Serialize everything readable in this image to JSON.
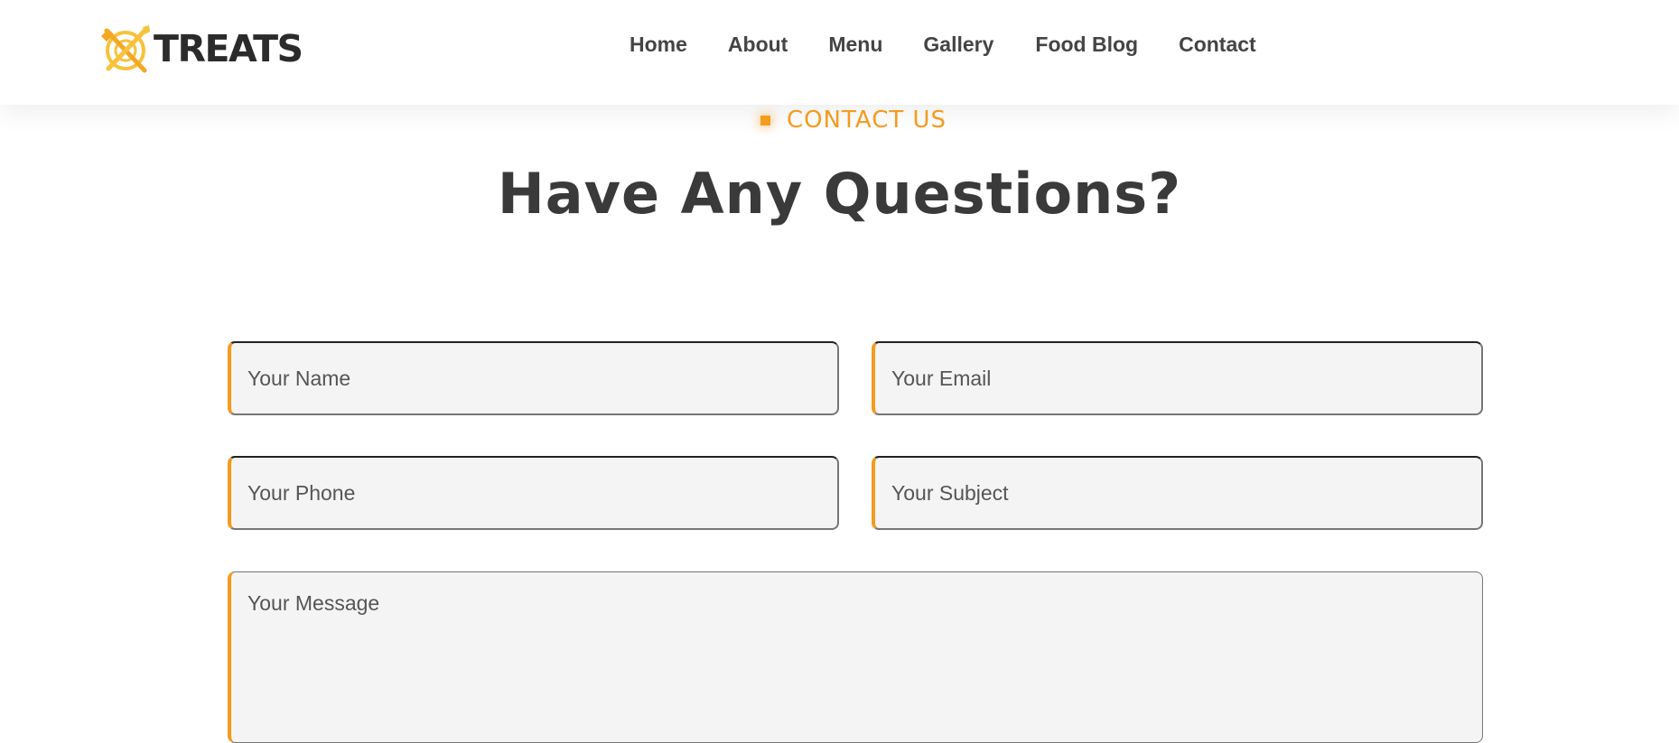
{
  "header": {
    "logo_text": "TREATS",
    "logo_icon": "crossed-utensils-plate-icon",
    "nav": {
      "home": "Home",
      "about": "About",
      "menu": "Menu",
      "gallery": "Gallery",
      "food_blog": "Food Blog",
      "contact": "Contact"
    }
  },
  "section": {
    "subtitle": "CONTACT US",
    "title": "Have Any Questions?"
  },
  "form": {
    "name_placeholder": "Your Name",
    "email_placeholder": "Your Email",
    "phone_placeholder": "Your Phone",
    "subject_placeholder": "Your Subject",
    "message_placeholder": "Your Message"
  },
  "colors": {
    "accent": "#f59b1d",
    "text_dark": "#3a3a3a",
    "nav_text": "#444444",
    "field_bg": "#f4f4f4"
  }
}
